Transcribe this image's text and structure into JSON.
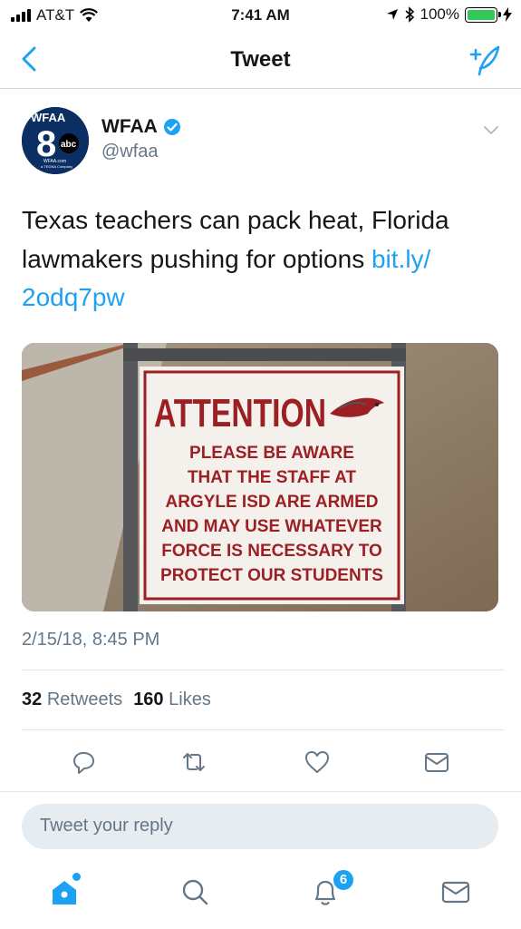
{
  "status_bar": {
    "carrier": "AT&T",
    "time": "7:41 AM",
    "battery": "100%",
    "icons": [
      "signal-icon",
      "wifi-icon",
      "location-arrow-icon",
      "bluetooth-icon",
      "battery-icon",
      "charging-bolt-icon"
    ]
  },
  "nav": {
    "title": "Tweet",
    "back_icon": "chevron-left-icon",
    "compose_icon": "compose-tweet-icon"
  },
  "tweet": {
    "author_name": "WFAA",
    "author_handle": "@wfaa",
    "verified": true,
    "avatar": {
      "logo_text": "WFAA",
      "channel_number": "8",
      "network": "abc",
      "footer": "WFAA.com",
      "company": "a TEGNA Company"
    },
    "text_main": "Texas teachers can pack heat, Florida lawmakers pushing for options ",
    "text_link": "bit.ly/ 2odq7pw",
    "media": {
      "sign_heading": "ATTENTION",
      "sign_lines": [
        "PLEASE BE AWARE",
        "THAT THE STAFF AT",
        "ARGYLE ISD ARE ARMED",
        "AND MAY USE WHATEVER",
        "FORCE IS NECESSARY TO",
        "PROTECT OUR STUDENTS"
      ]
    },
    "timestamp": "2/15/18, 8:45 PM",
    "retweets_count": "32",
    "retweets_label": "Retweets",
    "likes_count": "160",
    "likes_label": "Likes"
  },
  "actions": [
    "reply-icon",
    "retweet-icon",
    "like-icon",
    "direct-message-icon"
  ],
  "reply": {
    "placeholder": "Tweet your reply"
  },
  "tab_bar": {
    "tabs": [
      "home-icon",
      "search-icon",
      "notifications-icon",
      "messages-icon"
    ],
    "notification_badge": "6"
  },
  "colors": {
    "accent": "#1da1f2",
    "text": "#14171a",
    "secondary_text": "#657786",
    "sign_red": "#9c1f24"
  }
}
